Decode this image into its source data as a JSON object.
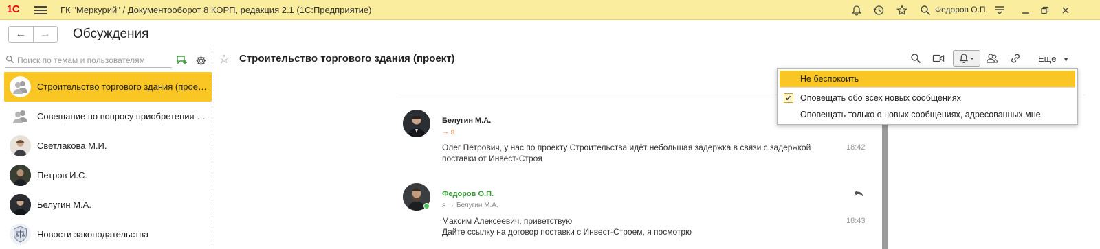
{
  "titlebar": {
    "logo": "1С",
    "title": "ГК \"Меркурий\" / Документооборот 8 КОРП, редакция 2.1  (1С:Предприятие)",
    "user": "Федоров О.П."
  },
  "nav": {
    "back": "←",
    "forward": "→",
    "page_title": "Обсуждения"
  },
  "sidebar": {
    "search_placeholder": "Поиск по темам и пользователям",
    "threads": [
      {
        "name": "Строительство торгового здания (проект)",
        "type": "group",
        "active": true
      },
      {
        "name": "Совещание по вопросу приобретения л...",
        "type": "group",
        "active": false
      },
      {
        "name": "Светлакова М.И.",
        "type": "person",
        "active": false
      },
      {
        "name": "Петров И.С.",
        "type": "person",
        "active": false
      },
      {
        "name": "Белугин М.А.",
        "type": "person",
        "active": false
      },
      {
        "name": "Новости законодательства",
        "type": "emblem",
        "active": false
      }
    ]
  },
  "main": {
    "title": "Строительство торгового здания (проект)",
    "more_label": "Еще",
    "messages": [
      {
        "author": "Белугин М.А.",
        "to": "→ я",
        "text": "Олег Петрович, у нас по проекту Строительства идёт небольшая задержка в связи с задержкой поставки от Инвест-Строя",
        "time": "18:42"
      },
      {
        "author": "Федоров О.П.",
        "to": "я → Белугин М.А.",
        "text": "Максим Алексеевич, приветствую\nДайте ссылку на договор поставки с Инвест-Строем, я посмотрю",
        "time": "18:43"
      }
    ]
  },
  "notify_menu": {
    "items": [
      {
        "label": "Не беспокоить",
        "highlighted": true,
        "checked": false
      },
      {
        "label": "Оповещать обо всех новых сообщениях",
        "highlighted": false,
        "checked": true
      },
      {
        "label": "Оповещать только о новых сообщениях, адресованных мне",
        "highlighted": false,
        "checked": false
      }
    ]
  },
  "colors": {
    "titlebar_bg": "#fbed9e",
    "accent": "#f9c623",
    "online": "#4fc35a",
    "author_self": "#3a9a3a",
    "addressee": "#e8772e"
  }
}
